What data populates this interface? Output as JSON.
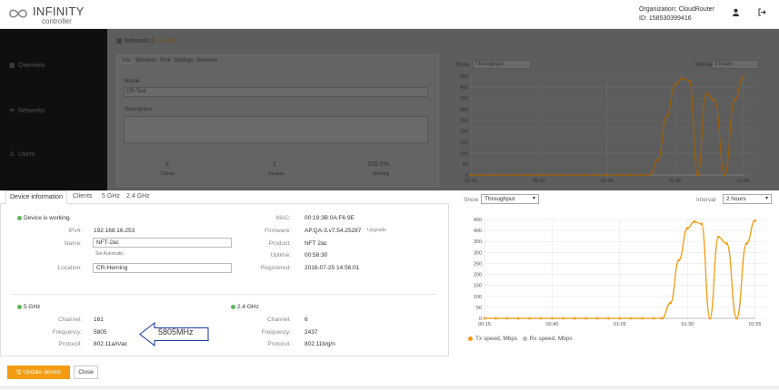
{
  "header": {
    "logo_word": "INFINITY",
    "logo_sub": "controller",
    "org_label": "Organization: CloudRouter",
    "org_id": "ID: 158530399416"
  },
  "sidebar": {
    "sections": [
      "",
      ""
    ],
    "items": [
      {
        "label": "Overview"
      },
      {
        "label": "Networks"
      },
      {
        "label": "Users"
      }
    ]
  },
  "background": {
    "breadcrumb_root": "Networks",
    "breadcrumb_current": "CR-Test",
    "tabs": [
      "Info",
      "Wireless",
      "IPv4",
      "Settings",
      "Services"
    ],
    "name_label": "Name:",
    "name_value": "CR-Test",
    "description_label": "Description:",
    "stats": [
      {
        "value": "2",
        "label": "Clients"
      },
      {
        "value": "1",
        "label": "Devices"
      },
      {
        "value": "100.0%",
        "label": "Working"
      }
    ],
    "show_label": "Show",
    "show_value": "Throughput",
    "interval_label": "Interval",
    "interval_value": "2 hours"
  },
  "device": {
    "tabs": [
      "Device information",
      "Clients",
      "5 GHz",
      "2.4 GHz"
    ],
    "status": "Device is working",
    "ipv4_label": "IPv4:",
    "ipv4": "192.168.16.253",
    "name_label": "Name:",
    "name": "NFT-2ac",
    "name_hint": "Set Automatic",
    "location_label": "Location:",
    "location": "CR-Herning",
    "mac_label": "MAC:",
    "mac": "00:19:3B:0A:F6:9E",
    "firmware_label": "Firmware:",
    "firmware": "AP.QA-3.v7.54.25287",
    "firmware_action": "Upgrade",
    "product_label": "Product:",
    "product": "NFT 2ac",
    "uptime_label": "Uptime:",
    "uptime": "00:58:30",
    "registered_label": "Registered:",
    "registered": "2016-07-25 14:56:01",
    "band5": {
      "title": "5 GHz",
      "channel_label": "Channel:",
      "channel": "161",
      "frequency_label": "Frequency:",
      "frequency": "5805",
      "protocol_label": "Protocol:",
      "protocol": "802.11a/n/ac"
    },
    "band24": {
      "title": "2.4 GHz",
      "channel_label": "Channel:",
      "channel": "6",
      "frequency_label": "Frequency:",
      "frequency": "2437",
      "protocol_label": "Protocol:",
      "protocol": "802.11b/g/n"
    },
    "annotation": "5805MHz"
  },
  "actions": {
    "update": "Update device",
    "close": "Close"
  },
  "chart_controls": {
    "show_label": "Show",
    "show_value": "Throughput",
    "interval_label": "Interval",
    "interval_value": "2 hours"
  },
  "colors": {
    "accent": "#f39c12",
    "rx": "#bbbbbb",
    "ok": "#5cb85c"
  },
  "chart_data": {
    "type": "line",
    "x": [
      "00:15",
      "00:40",
      "01:05",
      "01:30",
      "01:55"
    ],
    "yticks": [
      0,
      50,
      100,
      150,
      200,
      250,
      300,
      350,
      400,
      450
    ],
    "ylim": [
      0,
      450
    ],
    "series": [
      {
        "name": "Tx speed, Mbps",
        "points": [
          [
            0,
            0
          ],
          [
            0.04,
            0
          ],
          [
            0.08,
            0
          ],
          [
            0.12,
            0
          ],
          [
            0.16,
            0
          ],
          [
            0.2,
            0
          ],
          [
            0.24,
            0
          ],
          [
            0.28,
            0
          ],
          [
            0.32,
            0
          ],
          [
            0.36,
            0
          ],
          [
            0.4,
            0
          ],
          [
            0.44,
            0
          ],
          [
            0.48,
            0
          ],
          [
            0.52,
            0
          ],
          [
            0.56,
            0
          ],
          [
            0.6,
            0
          ],
          [
            0.63,
            0
          ],
          [
            0.66,
            70
          ],
          [
            0.69,
            265
          ],
          [
            0.72,
            410
          ],
          [
            0.745,
            440
          ],
          [
            0.77,
            430
          ],
          [
            0.8,
            0
          ],
          [
            0.83,
            370
          ],
          [
            0.86,
            340
          ],
          [
            0.895,
            0
          ],
          [
            0.93,
            340
          ],
          [
            0.96,
            445
          ]
        ]
      },
      {
        "name": "Rx speed, Mbps",
        "points": [
          [
            0,
            0
          ],
          [
            0.96,
            0
          ]
        ]
      }
    ],
    "legend": [
      "Tx speed, Mbps",
      "Rx speed, Mbps"
    ]
  }
}
